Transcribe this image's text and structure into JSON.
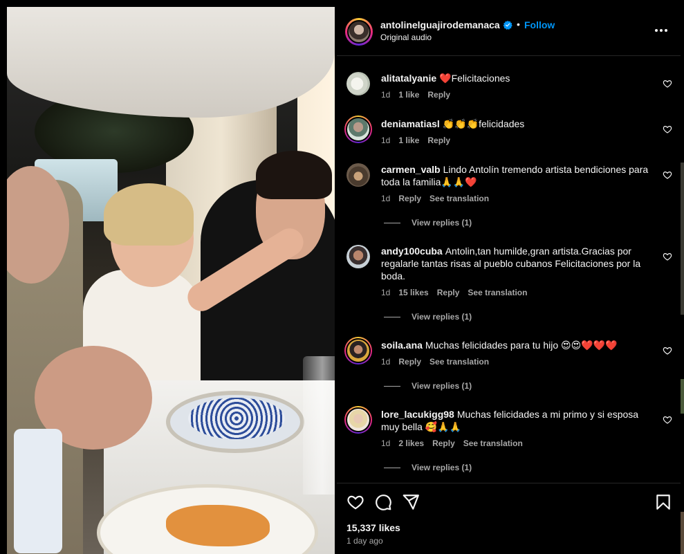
{
  "post": {
    "username": "antolinelguajirodemanaca",
    "verified": true,
    "follow_label": "Follow",
    "separator": "•",
    "audio": "Original audio",
    "media_alt": "wedding video frame"
  },
  "icons": {
    "verified": "verified-badge-icon",
    "more": "more-options-icon",
    "like": "heart-icon",
    "comment": "comment-icon",
    "share": "share-icon",
    "save": "bookmark-icon"
  },
  "colors": {
    "accent": "#0095f6",
    "background": "#000000",
    "text": "#f5f5f5",
    "muted": "#a8a8a8"
  },
  "comments": [
    {
      "username": "alitatalyanie",
      "text": "❤️Felicitaciones",
      "time": "1d",
      "likes": "1 like",
      "reply": "Reply",
      "translate": "",
      "view_replies": ""
    },
    {
      "username": "deniamatiasl",
      "text": "👏👏👏felicidades",
      "time": "1d",
      "likes": "1 like",
      "reply": "Reply",
      "translate": "",
      "view_replies": ""
    },
    {
      "username": "carmen_valb",
      "text": "Lindo Antolín tremendo artista bendiciones para toda la familia🙏🙏❤️",
      "time": "1d",
      "likes": "",
      "reply": "Reply",
      "translate": "See translation",
      "view_replies": "View replies (1)"
    },
    {
      "username": "andy100cuba",
      "text": "Antolin,tan humilde,gran artista.Gracias por regalarle tantas risas al pueblo cubanos Felicitaciones por la boda.",
      "time": "1d",
      "likes": "15 likes",
      "reply": "Reply",
      "translate": "See translation",
      "view_replies": "View replies (1)"
    },
    {
      "username": "soila.ana",
      "text": "Muchas felicidades para tu hijo 😍😍❤️❤️❤️",
      "time": "1d",
      "likes": "",
      "reply": "Reply",
      "translate": "See translation",
      "view_replies": "View replies (1)"
    },
    {
      "username": "lore_lacukigg98",
      "text": "Muchas felicidades a mi primo y si esposa muy bella 🥰🙏🙏",
      "time": "1d",
      "likes": "2 likes",
      "reply": "Reply",
      "translate": "See translation",
      "view_replies": "View replies (1)"
    }
  ],
  "footer": {
    "likes": "15,337 likes",
    "posted": "1 day ago"
  }
}
